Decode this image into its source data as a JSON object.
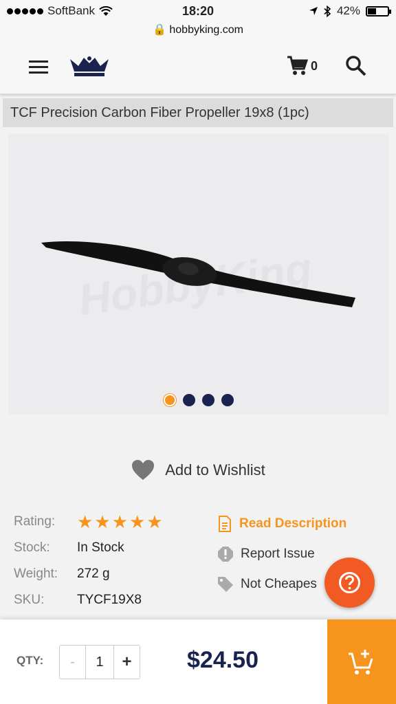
{
  "status_bar": {
    "carrier": "SoftBank",
    "time": "18:20",
    "battery": "42%",
    "battery_level": 0.42,
    "url": "hobbyking.com"
  },
  "header": {
    "cart_count": "0",
    "icons": [
      "menu-icon",
      "crown-logo",
      "cart-icon",
      "search-icon"
    ]
  },
  "product": {
    "title": "TCF Precision Carbon Fiber Propeller 19x8 (1pc)",
    "carousel": {
      "total": 4,
      "active": 1
    },
    "wishlist_label": "Add to Wishlist",
    "details": {
      "rating_label": "Rating:",
      "rating_stars": 5,
      "stock_label": "Stock:",
      "stock_value": "In Stock",
      "weight_label": "Weight:",
      "weight_value": "272 g",
      "sku_label": "SKU:",
      "sku_value": "TYCF19X8"
    },
    "actions": {
      "read_description": "Read Description",
      "report_issue": "Report Issue",
      "not_cheapest": "Not Cheapes"
    }
  },
  "bottom_bar": {
    "qty_label": "QTY:",
    "minus": "-",
    "qty_value": "1",
    "plus": "+",
    "price": "$24.50"
  },
  "colors": {
    "accent": "#f7941d",
    "navy": "#1a2250",
    "help": "#f15a22"
  }
}
